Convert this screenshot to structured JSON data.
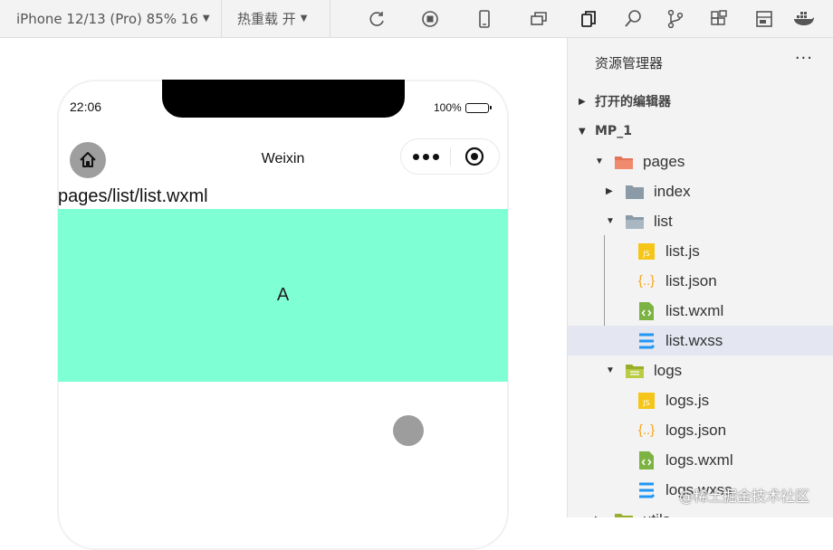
{
  "toolbar": {
    "device_label": "iPhone 12/13 (Pro) 85% 16",
    "hot_reload_label": "热重载 开"
  },
  "simulator": {
    "time": "22:06",
    "battery": "100%",
    "nav_title": "Weixin",
    "page_path": "pages/list/list.wxml",
    "box_text": "A",
    "box_color": "#7fffd4"
  },
  "explorer": {
    "title": "资源管理器",
    "more": "···",
    "sections": {
      "open_editors": "打开的编辑器",
      "project": "MP_1"
    },
    "tree": {
      "pages": "pages",
      "index": "index",
      "list": "list",
      "list_js": "list.js",
      "list_json": "list.json",
      "list_wxml": "list.wxml",
      "list_wxss": "list.wxss",
      "logs": "logs",
      "logs_js": "logs.js",
      "logs_json": "logs.json",
      "logs_wxml": "logs.wxml",
      "logs_wxss": "logs.wxss",
      "utils": "utils"
    }
  },
  "watermark": "@稀土掘金技术社区",
  "colors": {
    "js": "#f5c518",
    "json": "#f5a623",
    "wxml": "#7cb342",
    "wxss": "#2196f3",
    "folder": "#8a9aa6"
  }
}
